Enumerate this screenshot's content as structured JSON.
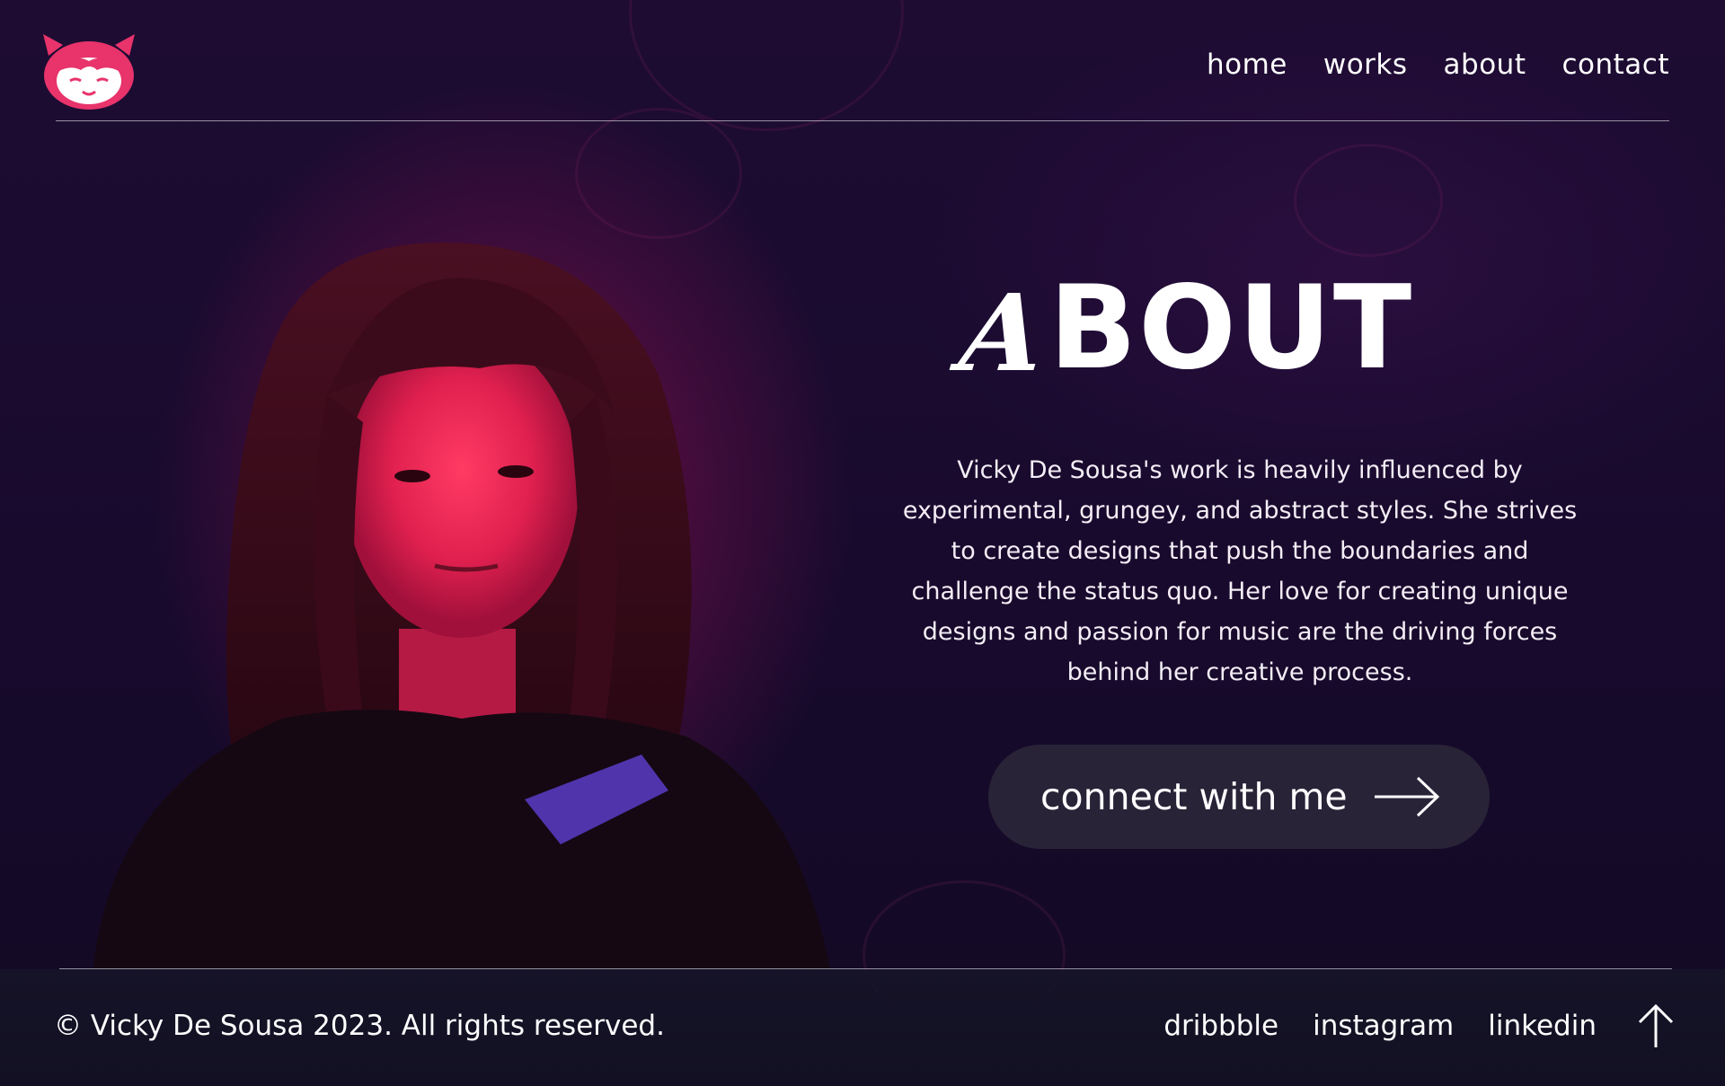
{
  "logo": {
    "icon": "girl-face-logo",
    "color": "#e8336b"
  },
  "nav": [
    {
      "label": "home"
    },
    {
      "label": "works"
    },
    {
      "label": "about"
    },
    {
      "label": "contact"
    }
  ],
  "about": {
    "title_initial": "A",
    "title_rest": "BOUT",
    "paragraph": "Vicky De Sousa's work is heavily influenced by experimental, grungey, and abstract styles. She strives to create designs that push the boundaries and challenge the status quo. Her love for creating unique designs and passion for music are the driving forces behind her creative process.",
    "cta_label": "connect with me",
    "cta_icon": "arrow-right-icon"
  },
  "footer": {
    "copyright": "© Vicky De Sousa 2023. All rights reserved.",
    "social": [
      {
        "label": "dribbble"
      },
      {
        "label": "instagram"
      },
      {
        "label": "linkedin"
      }
    ],
    "scroll_top_icon": "arrow-up-icon"
  },
  "colors": {
    "background": "#1a0c2e",
    "accent": "#e8336b",
    "button": "#292338",
    "text": "#ffffff"
  }
}
